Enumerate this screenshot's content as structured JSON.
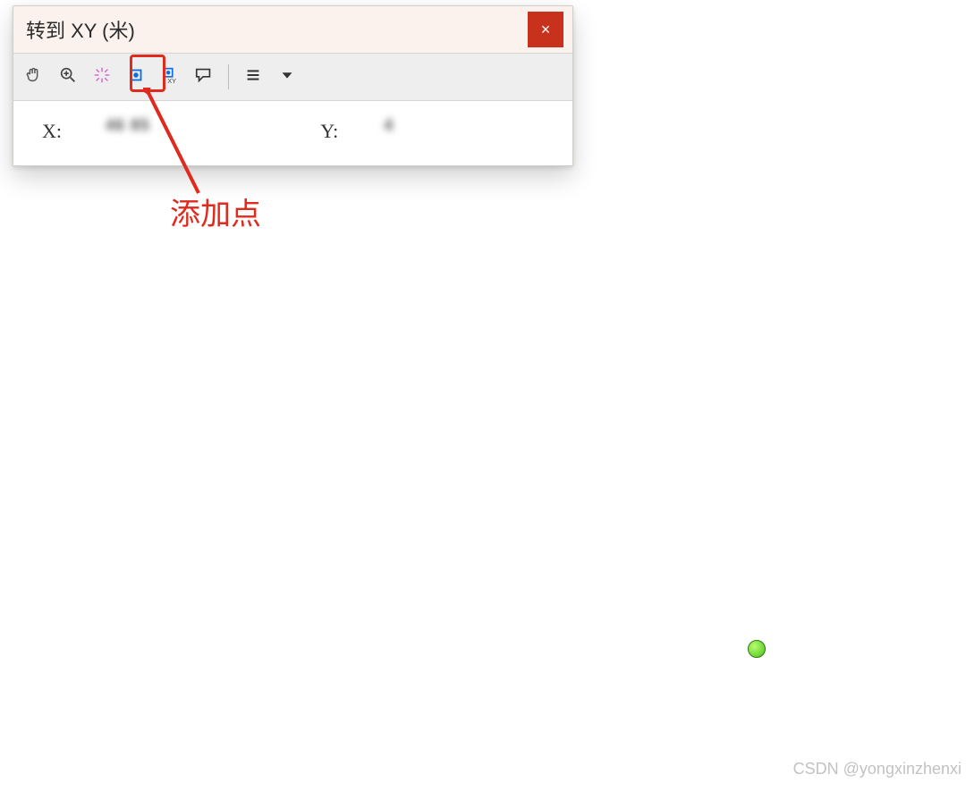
{
  "dialog": {
    "title": "转到 XY   (米)",
    "close_tooltip": "×"
  },
  "toolbar": {
    "pan": "pan-icon",
    "zoomin": "zoom-in-icon",
    "flash": "flash-icon",
    "addpoint": "add-point-icon",
    "addlabelpoint": "add-labeled-point-icon",
    "callout": "callout-icon",
    "menu": "menu-icon",
    "dropdown": "dropdown-icon"
  },
  "coords": {
    "x_label": "X:",
    "y_label": "Y:",
    "x_value": "  46 85  ",
    "y_value": "4         "
  },
  "annotation": {
    "label": "添加点"
  },
  "watermark": "CSDN @yongxinzhenxi"
}
